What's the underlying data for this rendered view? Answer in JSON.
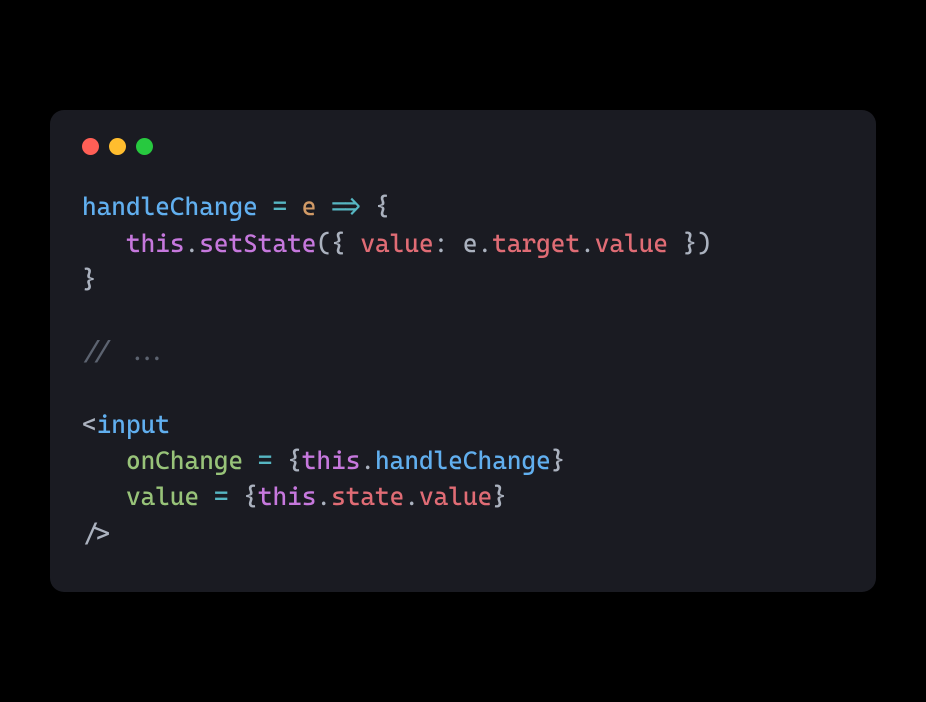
{
  "window": {
    "dots": [
      "red",
      "yellow",
      "green"
    ]
  },
  "code": {
    "tokens": [
      {
        "t": "handleChange",
        "c": "c-id"
      },
      {
        "t": " ",
        "c": "c-punc"
      },
      {
        "t": "=",
        "c": "c-op"
      },
      {
        "t": " ",
        "c": "c-punc"
      },
      {
        "t": "e",
        "c": "c-prop"
      },
      {
        "t": " ",
        "c": "c-punc"
      },
      {
        "t": "=>",
        "c": "c-op"
      },
      {
        "t": " ",
        "c": "c-punc"
      },
      {
        "t": "{",
        "c": "c-punc"
      },
      {
        "t": "\n   ",
        "c": "c-punc"
      },
      {
        "t": "this",
        "c": "c-kw"
      },
      {
        "t": ".",
        "c": "c-punc"
      },
      {
        "t": "setState",
        "c": "c-fn"
      },
      {
        "t": "(",
        "c": "c-punc"
      },
      {
        "t": "{ ",
        "c": "c-punc"
      },
      {
        "t": "value",
        "c": "c-prop2"
      },
      {
        "t": ": ",
        "c": "c-punc"
      },
      {
        "t": "e",
        "c": "c-param"
      },
      {
        "t": ".",
        "c": "c-punc"
      },
      {
        "t": "target",
        "c": "c-prop2"
      },
      {
        "t": ".",
        "c": "c-punc"
      },
      {
        "t": "value",
        "c": "c-prop2"
      },
      {
        "t": " }",
        "c": "c-punc"
      },
      {
        "t": ")",
        "c": "c-punc"
      },
      {
        "t": "\n",
        "c": "c-punc"
      },
      {
        "t": "}",
        "c": "c-punc"
      },
      {
        "t": "\n\n",
        "c": "c-punc"
      },
      {
        "t": "// ...",
        "c": "c-cmt"
      },
      {
        "t": "\n\n",
        "c": "c-punc"
      },
      {
        "t": "<",
        "c": "c-punc"
      },
      {
        "t": "input",
        "c": "c-id"
      },
      {
        "t": "\n   ",
        "c": "c-punc"
      },
      {
        "t": "onChange",
        "c": "c-attr"
      },
      {
        "t": " ",
        "c": "c-punc"
      },
      {
        "t": "=",
        "c": "c-op"
      },
      {
        "t": " ",
        "c": "c-punc"
      },
      {
        "t": "{",
        "c": "c-punc"
      },
      {
        "t": "this",
        "c": "c-kw"
      },
      {
        "t": ".",
        "c": "c-punc"
      },
      {
        "t": "handleChange",
        "c": "c-id"
      },
      {
        "t": "}",
        "c": "c-punc"
      },
      {
        "t": "\n   ",
        "c": "c-punc"
      },
      {
        "t": "value",
        "c": "c-attr"
      },
      {
        "t": " ",
        "c": "c-punc"
      },
      {
        "t": "=",
        "c": "c-op"
      },
      {
        "t": " ",
        "c": "c-punc"
      },
      {
        "t": "{",
        "c": "c-punc"
      },
      {
        "t": "this",
        "c": "c-kw"
      },
      {
        "t": ".",
        "c": "c-punc"
      },
      {
        "t": "state",
        "c": "c-prop2"
      },
      {
        "t": ".",
        "c": "c-punc"
      },
      {
        "t": "value",
        "c": "c-prop2"
      },
      {
        "t": "}",
        "c": "c-punc"
      },
      {
        "t": "\n",
        "c": "c-punc"
      },
      {
        "t": "/>",
        "c": "c-punc"
      }
    ]
  }
}
